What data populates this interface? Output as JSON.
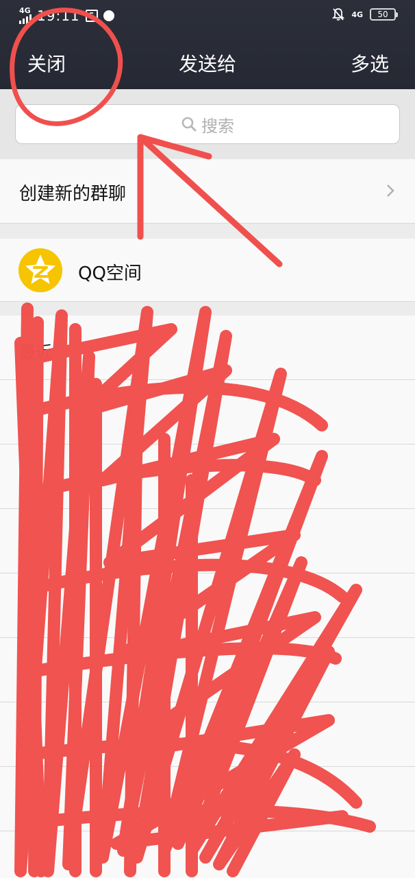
{
  "status_bar": {
    "network_label": "4G",
    "time": "19:11",
    "right_network": "4G",
    "battery": "50"
  },
  "nav": {
    "close_label": "关闭",
    "title": "发送给",
    "multi_select_label": "多选"
  },
  "search": {
    "placeholder": "搜索"
  },
  "rows": {
    "create_group_label": "创建新的群聊",
    "qzone_label": "QQ空间",
    "recent_label": "最近"
  },
  "colors": {
    "nav_bg": "#2c2f3a",
    "qzone_yellow": "#f6c400",
    "annotation_red": "#f0504d"
  }
}
